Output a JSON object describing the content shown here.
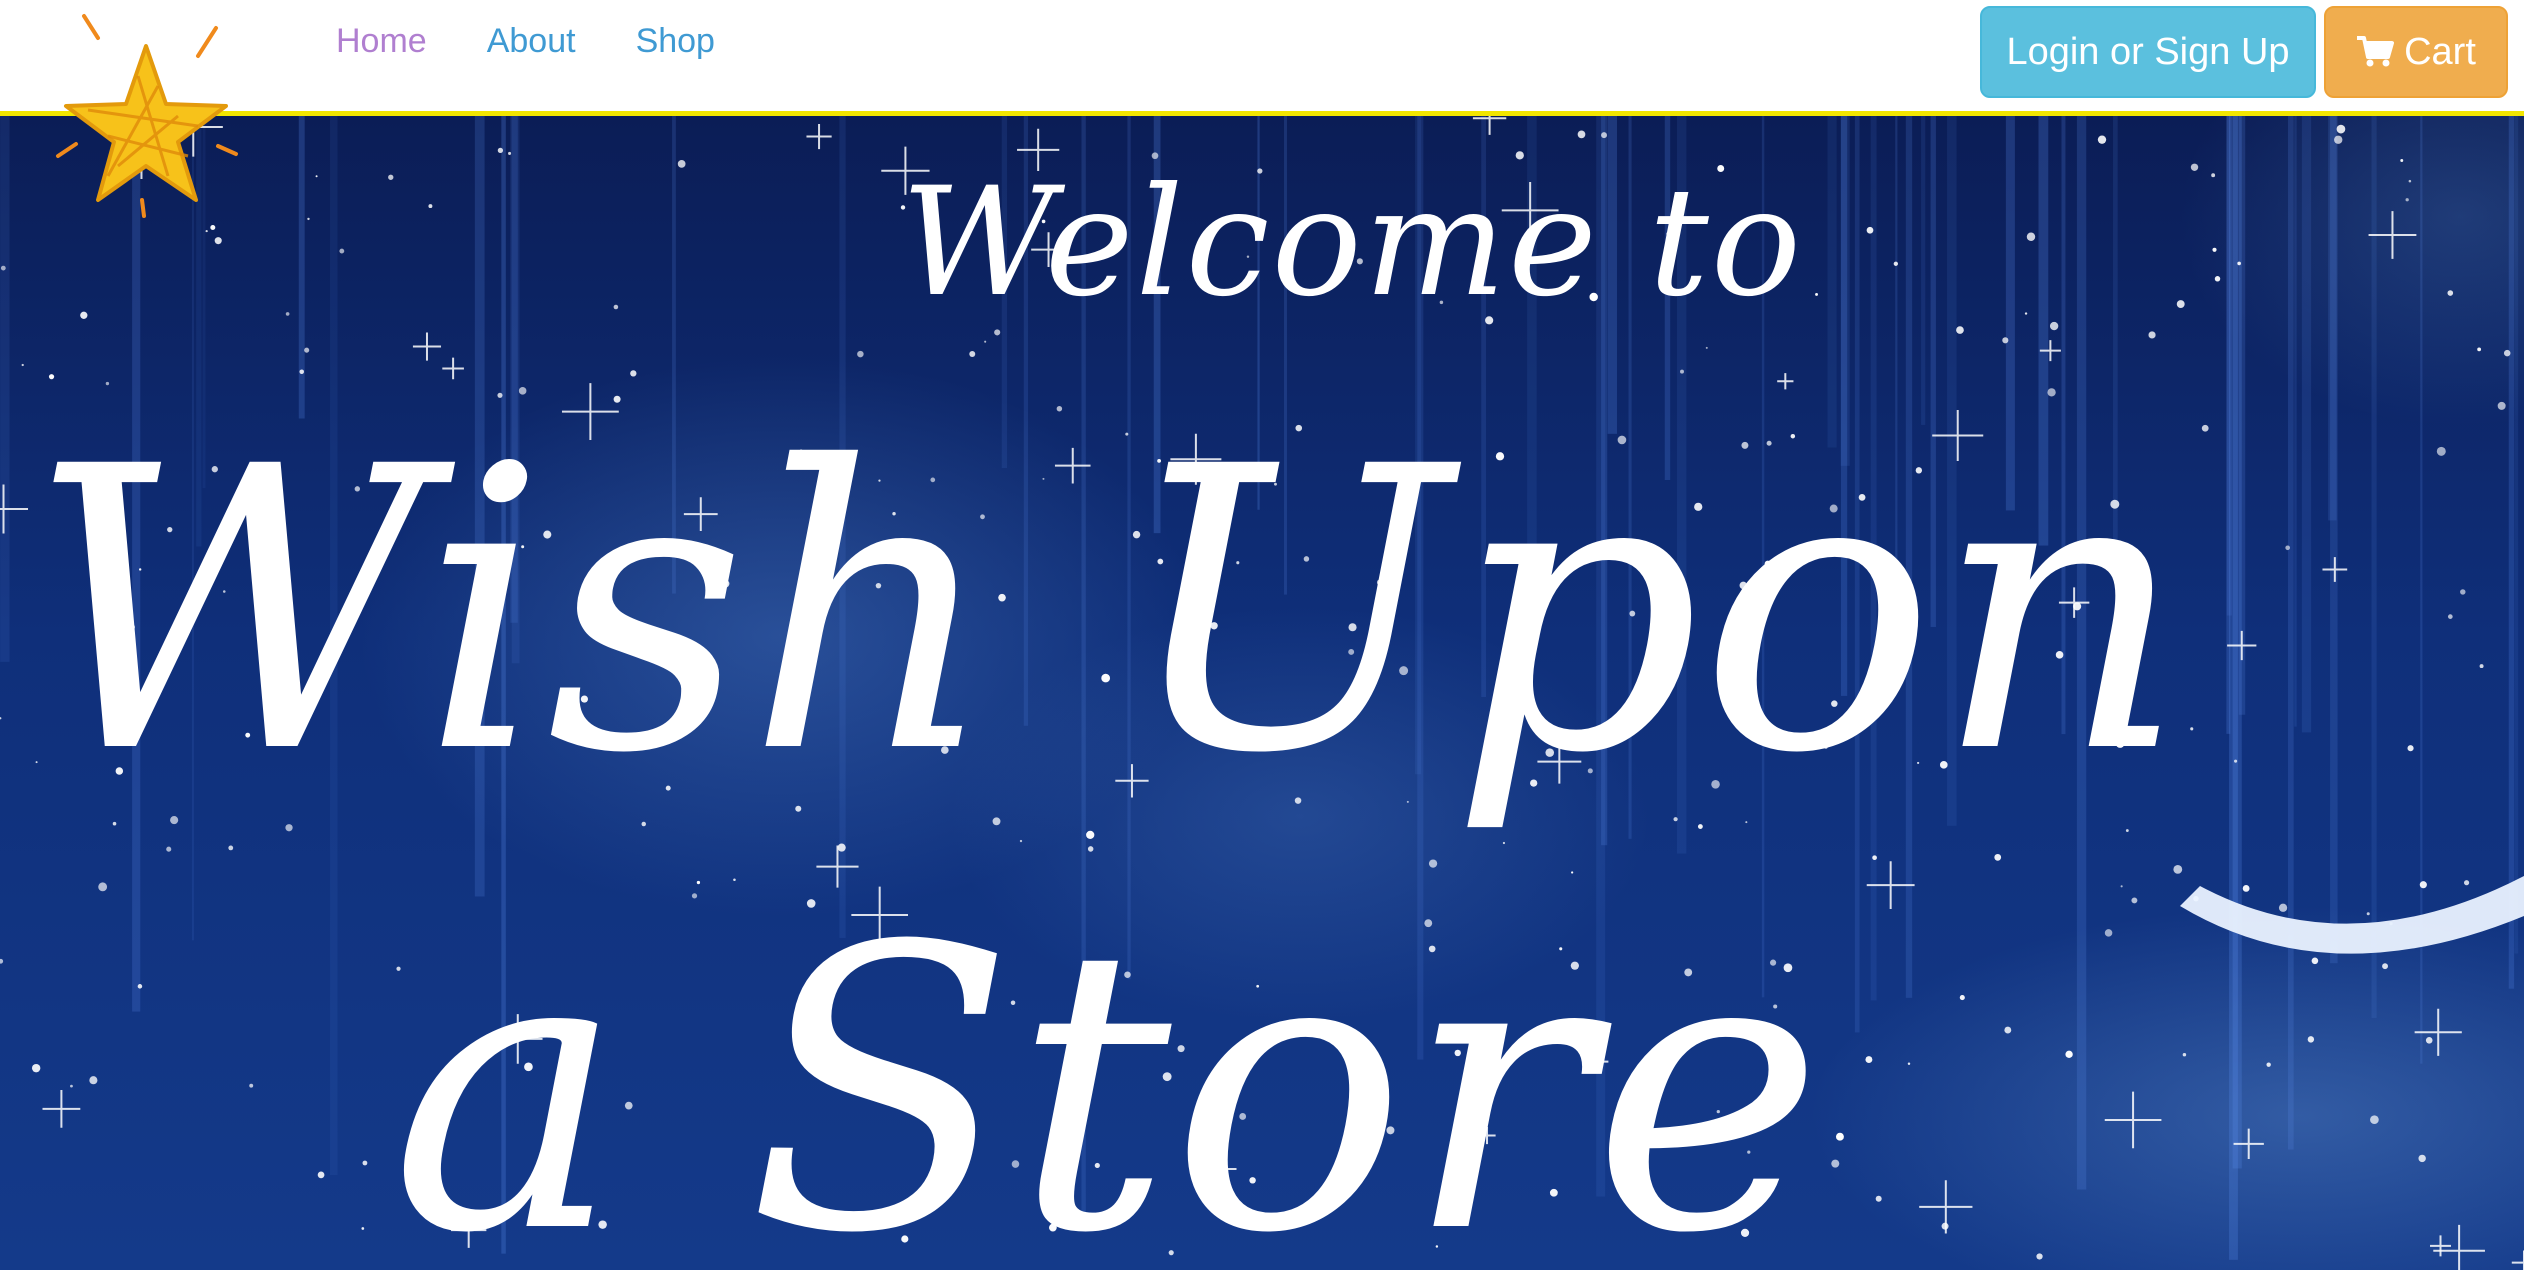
{
  "nav": {
    "links": [
      {
        "label": "Home"
      },
      {
        "label": "About"
      },
      {
        "label": "Shop"
      }
    ],
    "login_label": "Login or Sign Up",
    "cart_label": "Cart",
    "cart_icon": "shopping-cart-icon",
    "logo_icon": "star-logo-icon"
  },
  "hero": {
    "welcome": "Welcome to",
    "title_line1": "Wish Upon",
    "title_line2": "a Store",
    "background": "night-sky-stars-moon"
  },
  "colors": {
    "nav_active": "#b07fd0",
    "nav_link": "#3f9ad3",
    "login_button": "#5bc0de",
    "cart_button": "#f0ad4e",
    "nav_border": "#f2e600",
    "sky": "#0f2f7a"
  }
}
